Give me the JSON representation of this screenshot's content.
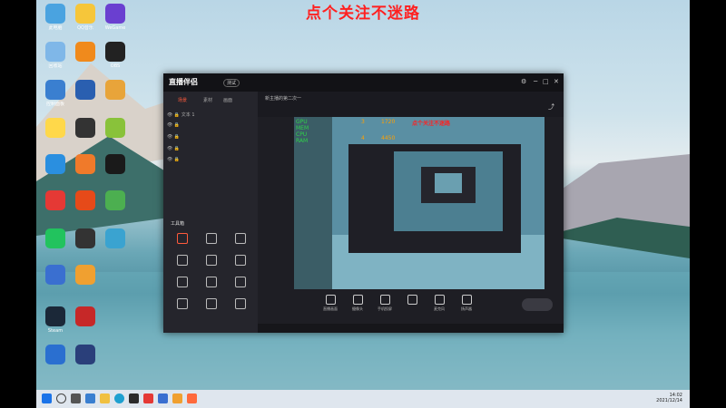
{
  "banner_text": "点个关注不迷路",
  "desktop_icons": [
    {
      "label": "此电脑",
      "color": "#4aa3e0"
    },
    {
      "label": "QQ音乐",
      "color": "#f6c63a"
    },
    {
      "label": "WeGame",
      "color": "#6a3fd0"
    },
    {
      "label": "回收站",
      "color": "#7fb7e8"
    },
    {
      "label": "",
      "color": "#f08a1c"
    },
    {
      "label": "OBS",
      "color": "#222222"
    },
    {
      "label": "控制面板",
      "color": "#3a7fd0"
    },
    {
      "label": "",
      "color": "#2a5fb0"
    },
    {
      "label": "",
      "color": "#e8a43a"
    },
    {
      "label": "",
      "color": "#ffd84a"
    },
    {
      "label": "",
      "color": "#333333"
    },
    {
      "label": "",
      "color": "#89c23a"
    },
    {
      "label": "",
      "color": "#2a8fe0"
    },
    {
      "label": "",
      "color": "#f07a2a"
    },
    {
      "label": "",
      "color": "#1a1a1a"
    },
    {
      "label": "",
      "color": "#e53935"
    },
    {
      "label": "",
      "color": "#e64a19"
    },
    {
      "label": "",
      "color": "#4caf50"
    },
    {
      "label": "",
      "color": "#22c35e"
    },
    {
      "label": "",
      "color": "#333333"
    },
    {
      "label": "",
      "color": "#3aa3d0"
    },
    {
      "label": "",
      "color": "#3a6fd0"
    },
    {
      "label": "",
      "color": "#f0a030"
    },
    {
      "label": "Steam",
      "color": "#1b2838"
    },
    {
      "label": "",
      "color": "#c62828"
    },
    {
      "label": "",
      "color": "#2a6fd0"
    },
    {
      "label": "",
      "color": "#2a3f7a"
    }
  ],
  "window": {
    "logo_text": "直播伴侣",
    "badge": "测试",
    "sidebar_tabs": [
      "场景",
      "素材",
      "画面"
    ],
    "scene_rows": [
      "文本 1",
      "",
      "",
      "",
      ""
    ],
    "toolbox_title": "工具箱",
    "tools": [
      "",
      "",
      "",
      "",
      "",
      "",
      "",
      "",
      "",
      "",
      "",
      ""
    ],
    "top_text_1": "新主播的第二次一",
    "top_text_2": "",
    "top_text_3": "",
    "bottom_items": [
      "直播画面",
      "摄像头",
      "手机投屏",
      "",
      "麦克风",
      "扬声器"
    ],
    "go_live": "",
    "status_text": ""
  },
  "overlay_stats": {
    "labels": [
      "GPU",
      "MEM",
      "CPU",
      "RAM"
    ],
    "num1": "3",
    "num2": "1720",
    "num3": "4",
    "num4": "4450",
    "red_text": "点个关注不迷路"
  },
  "taskbar": {
    "time": "14:02",
    "date": "2021/12/14"
  }
}
